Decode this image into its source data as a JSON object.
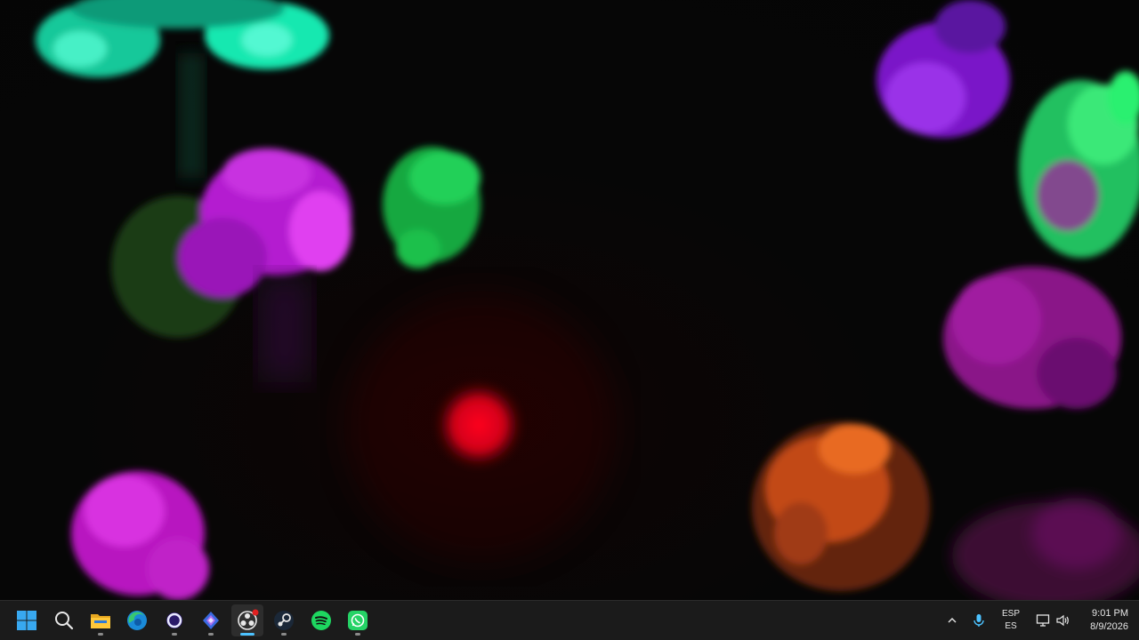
{
  "desktop": {
    "wallpaper": "fluid-smoke-wallpaper",
    "accent_colors": [
      "#14e8b0",
      "#c020d8",
      "#18c850",
      "#e00018",
      "#e86020",
      "#8a20e0"
    ]
  },
  "taskbar": {
    "pinned": [
      {
        "name": "start",
        "icon": "windows-logo-icon"
      },
      {
        "name": "search",
        "icon": "search-icon"
      },
      {
        "name": "file-explorer",
        "icon": "folder-icon"
      },
      {
        "name": "edge",
        "icon": "edge-browser-icon"
      },
      {
        "name": "cortana",
        "icon": "ring-icon"
      },
      {
        "name": "app-diamond",
        "icon": "diamond-app-icon"
      },
      {
        "name": "obs",
        "icon": "obs-icon"
      },
      {
        "name": "steam",
        "icon": "steam-icon"
      },
      {
        "name": "spotify",
        "icon": "spotify-icon"
      },
      {
        "name": "whatsapp",
        "icon": "whatsapp-icon"
      }
    ],
    "tray": {
      "chevron": "chevron-up-icon",
      "mic": "microphone-icon",
      "lang_line1": "ESP",
      "lang_line2": "ES",
      "network": "network-icon",
      "volume": "volume-icon",
      "time": "9:01 PM",
      "date": "8/9/2026"
    }
  }
}
